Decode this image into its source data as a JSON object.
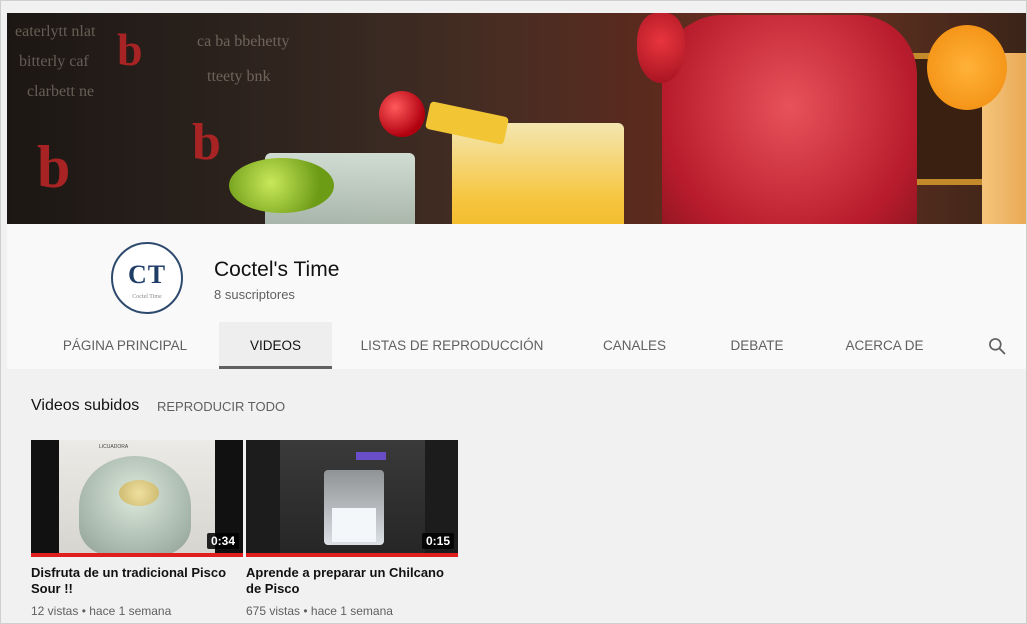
{
  "channel": {
    "name": "Coctel's Time",
    "subscribers": "8 suscriptores",
    "avatar_monogram": "CT",
    "avatar_subtitle": "Coctel Time"
  },
  "tabs": [
    {
      "label": "PÁGINA PRINCIPAL",
      "active": false
    },
    {
      "label": "VIDEOS",
      "active": true
    },
    {
      "label": "LISTAS DE REPRODUCCIÓN",
      "active": false
    },
    {
      "label": "CANALES",
      "active": false
    },
    {
      "label": "DEBATE",
      "active": false
    },
    {
      "label": "ACERCA DE",
      "active": false
    }
  ],
  "section": {
    "title": "Videos subidos",
    "play_all": "REPRODUCIR TODO"
  },
  "videos": [
    {
      "title": "Disfruta de un tradicional Pisco Sour !!",
      "duration": "0:34",
      "meta": "12 vistas • hace 1 semana"
    },
    {
      "title": "Aprende a preparar un Chilcano de Pisco",
      "duration": "0:15",
      "meta": "675 vistas • hace 1 semana"
    }
  ],
  "icons": {
    "search": "search-icon"
  },
  "colors": {
    "progress": "#e01e1e",
    "active_tab_underline": "#606060",
    "avatar_border": "#2d4a6e"
  }
}
